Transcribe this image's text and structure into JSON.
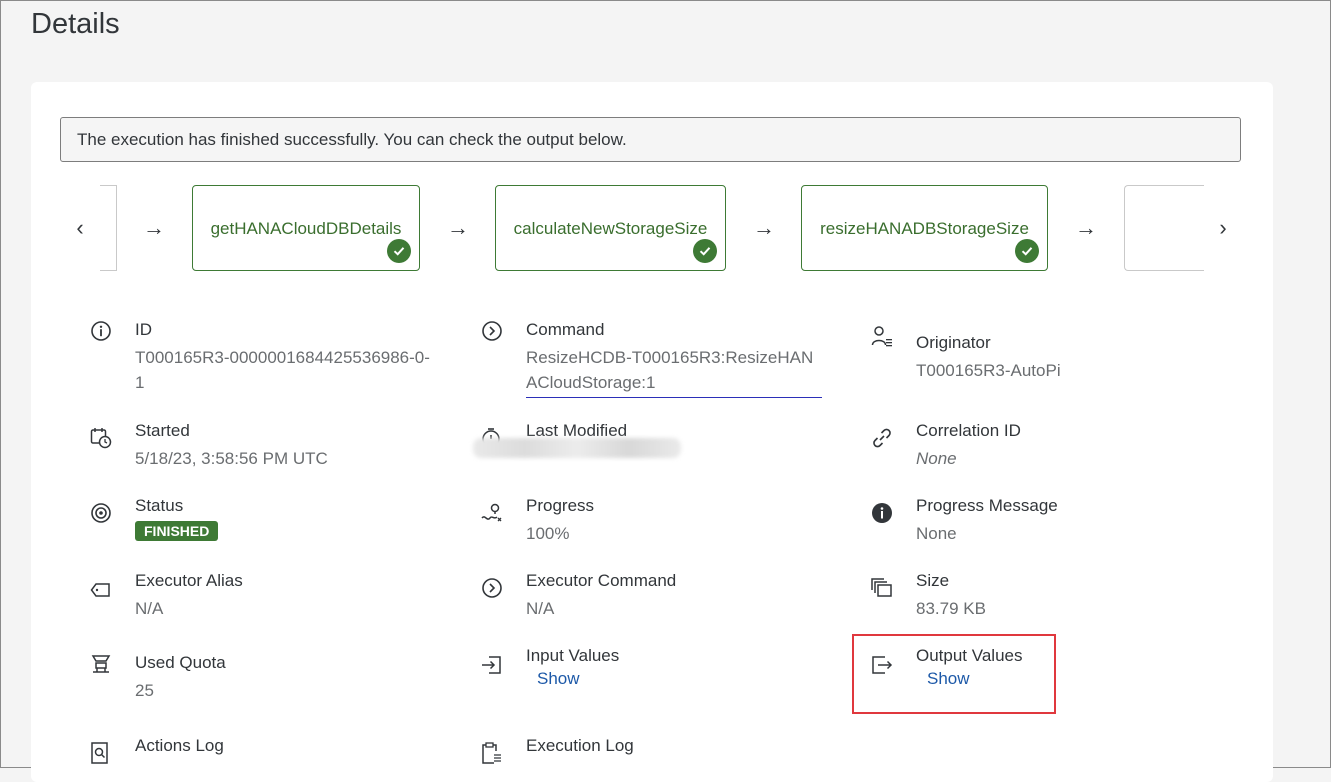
{
  "page": {
    "title": "Details"
  },
  "banner": {
    "message": "The execution has finished successfully. You can check the output below."
  },
  "steps": [
    {
      "name": "getHANACloudDBDetails",
      "status": "success"
    },
    {
      "name": "calculateNewStorageSize",
      "status": "success"
    },
    {
      "name": "resizeHANADBStorageSize",
      "status": "success"
    }
  ],
  "nav": {
    "prev": "‹",
    "next": "›",
    "arrow": "→"
  },
  "fields": {
    "id": {
      "label": "ID",
      "value": "T000165R3-0000001684425536986-0-1"
    },
    "command": {
      "label": "Command",
      "value": "ResizeHCDB-T000165R3:ResizeHANACloudStorage:1"
    },
    "originator": {
      "label": "Originator",
      "value": "T000165R3-AutoPi"
    },
    "started": {
      "label": "Started",
      "value": "5/18/23, 3:58:56 PM UTC"
    },
    "last_modified": {
      "label": "Last Modified",
      "value": ""
    },
    "correlation_id": {
      "label": "Correlation ID",
      "value": "None"
    },
    "status": {
      "label": "Status",
      "value": "FINISHED"
    },
    "progress": {
      "label": "Progress",
      "value": "100%"
    },
    "progress_message": {
      "label": "Progress Message",
      "value": "None"
    },
    "executor_alias": {
      "label": "Executor Alias",
      "value": "N/A"
    },
    "executor_command": {
      "label": "Executor Command",
      "value": "N/A"
    },
    "size": {
      "label": "Size",
      "value": "83.79 KB"
    },
    "used_quota": {
      "label": "Used Quota",
      "value": "25"
    },
    "input_values": {
      "label": "Input Values",
      "link": "Show"
    },
    "output_values": {
      "label": "Output Values",
      "link": "Show"
    },
    "actions_log": {
      "label": "Actions Log"
    },
    "execution_log": {
      "label": "Execution Log"
    }
  },
  "colors": {
    "success": "#3e7a35",
    "link": "#1d59a8",
    "highlight": "#e0383e"
  }
}
